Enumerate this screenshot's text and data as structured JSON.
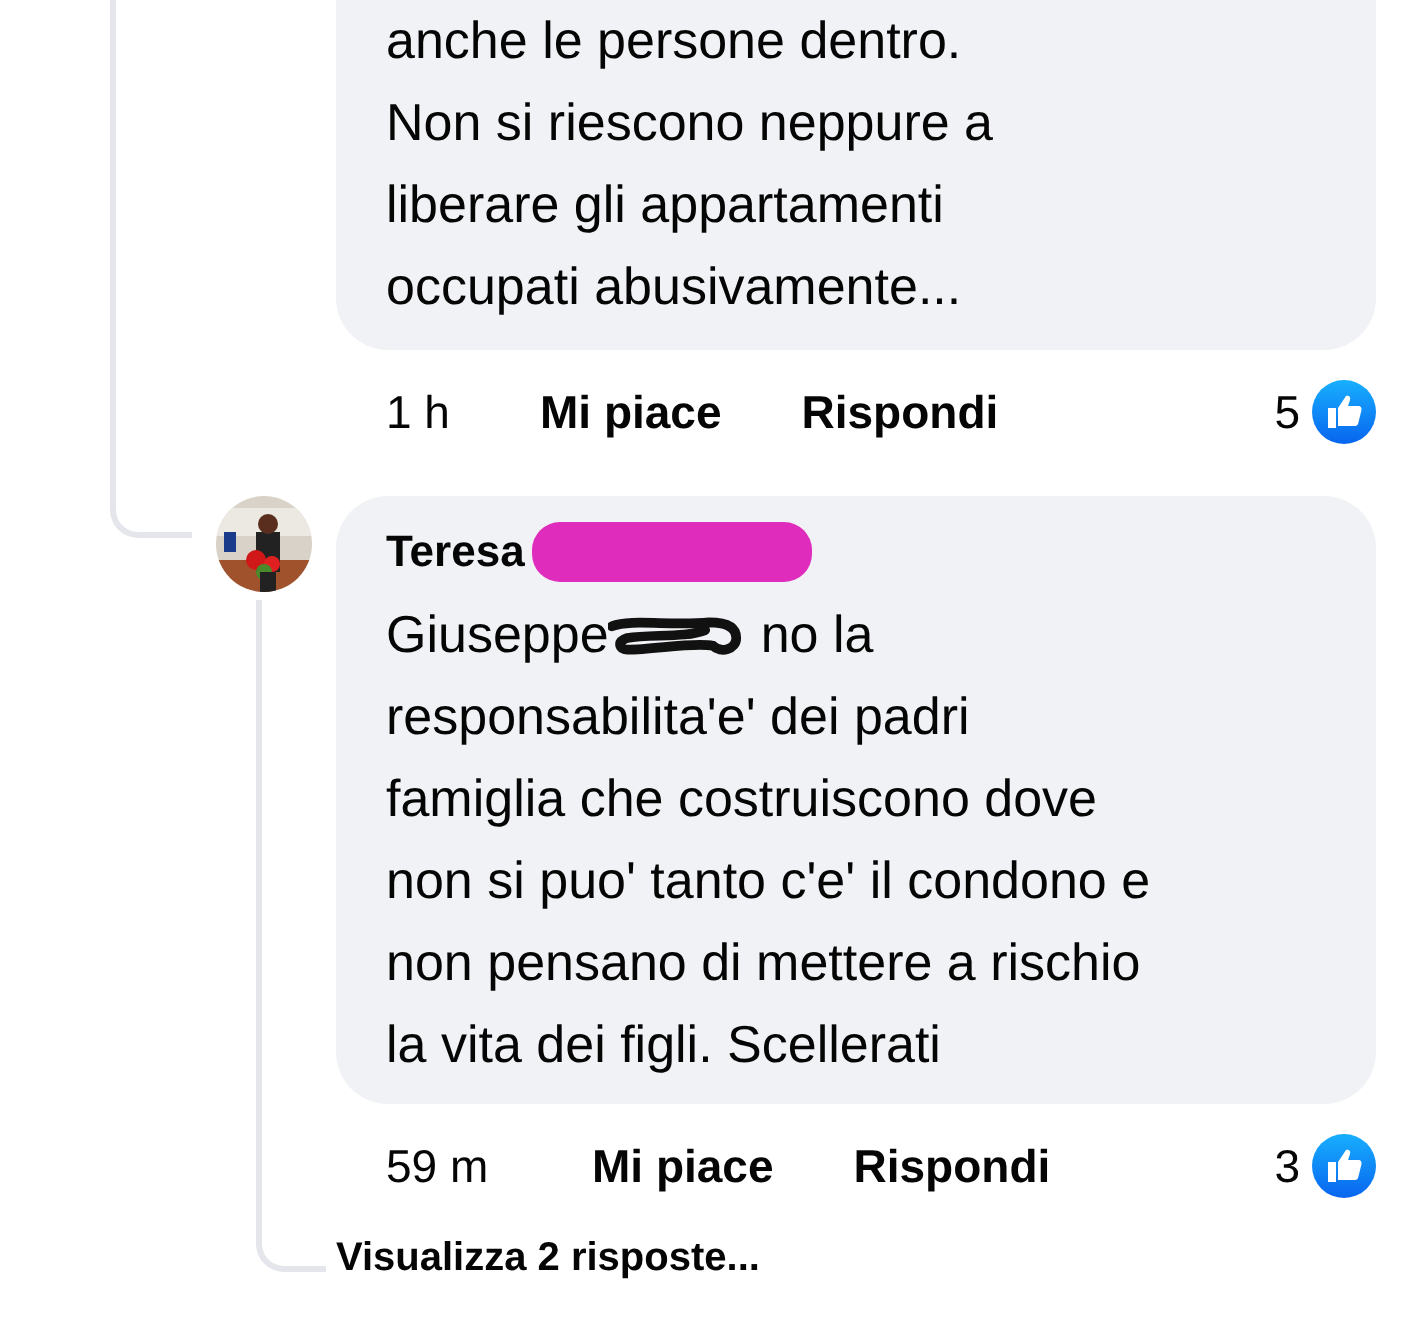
{
  "comments": [
    {
      "kind": "cut",
      "text": "anche le persone dentro.\nNon si riescono neppure a\nliberare gli appartamenti\noccupati abusivamente...",
      "time": "1 h",
      "like_label": "Mi piace",
      "reply_label": "Rispondi",
      "reaction_count": "5"
    },
    {
      "kind": "reply",
      "author": "Teresa",
      "mention": "Giuseppe",
      "text": "no la\nresponsabilita'e' dei padri\nfamiglia che costruiscono dove\nnon si puo' tanto c'e' il condono e\nnon pensano di mettere a rischio\nla vita dei figli. Scellerati",
      "time": "59 m",
      "like_label": "Mi piace",
      "reply_label": "Rispondi",
      "reaction_count": "3",
      "more_replies": "Visualizza 2 risposte..."
    }
  ]
}
